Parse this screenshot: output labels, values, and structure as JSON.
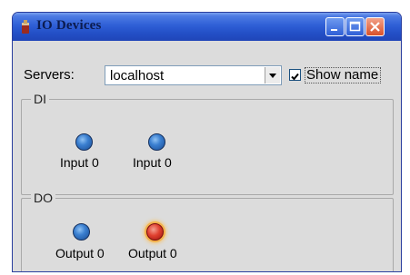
{
  "window": {
    "title": "IO Devices"
  },
  "servers": {
    "label": "Servers:",
    "value": "localhost"
  },
  "show_name": {
    "label": "Show name",
    "checked": true
  },
  "di": {
    "legend": "DI",
    "inputs": [
      {
        "label": "Input 0",
        "state": "off"
      },
      {
        "label": "Input 0",
        "state": "off"
      }
    ]
  },
  "do": {
    "legend": "DO",
    "outputs": [
      {
        "label": "Output 0",
        "state": "off"
      },
      {
        "label": "Output 0",
        "state": "on"
      }
    ]
  },
  "colors": {
    "led_off": "#3a7fd0",
    "led_on": "#e0402f",
    "title_bar": "#2f5fd6",
    "window_bg": "#dcdcdc"
  }
}
